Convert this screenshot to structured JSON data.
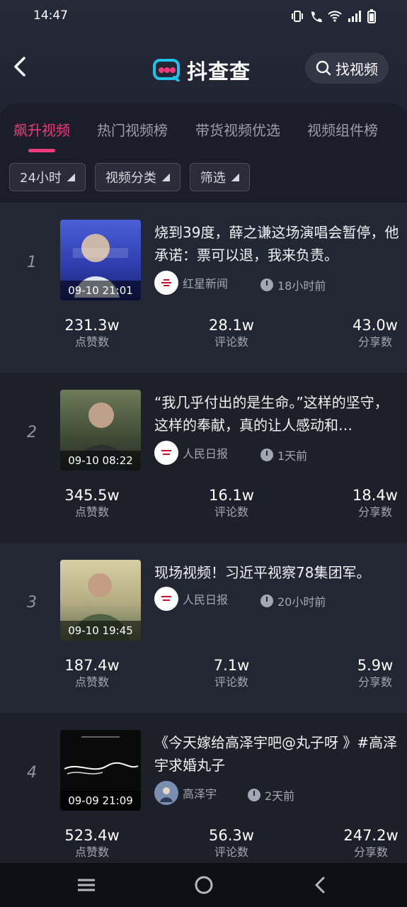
{
  "status": {
    "time": "14:47"
  },
  "header": {
    "logo_text": "抖查查",
    "find_label": "找视频"
  },
  "tabs": [
    {
      "label": "飙升视频"
    },
    {
      "label": "热门视频榜"
    },
    {
      "label": "带货视频优选"
    },
    {
      "label": "视频组件榜"
    }
  ],
  "filters": [
    {
      "label": "24小时"
    },
    {
      "label": "视频分类"
    },
    {
      "label": "筛选"
    }
  ],
  "items": [
    {
      "rank": "1",
      "date": "09-10 21:01",
      "title": "烧到39度，薛之谦这场演唱会暂停，他承诺：票可以退，我来负责。",
      "source": "红星新闻",
      "ago": "18小时前",
      "stats": [
        {
          "value": "231.3w",
          "label": "点赞数"
        },
        {
          "value": "28.1w",
          "label": "评论数"
        },
        {
          "value": "43.0w",
          "label": "分享数"
        }
      ]
    },
    {
      "rank": "2",
      "date": "09-10 08:22",
      "title": "“我几乎付出的是生命。”这样的坚守，这样的奉献，真的让人感动和…",
      "source": "人民日报",
      "ago": "1天前",
      "stats": [
        {
          "value": "345.5w",
          "label": "点赞数"
        },
        {
          "value": "16.1w",
          "label": "评论数"
        },
        {
          "value": "18.4w",
          "label": "分享数"
        }
      ]
    },
    {
      "rank": "3",
      "date": "09-10 19:45",
      "title": "现场视频！习近平视察78集团军。",
      "source": "人民日报",
      "ago": "20小时前",
      "stats": [
        {
          "value": "187.4w",
          "label": "点赞数"
        },
        {
          "value": "7.1w",
          "label": "评论数"
        },
        {
          "value": "5.9w",
          "label": "分享数"
        }
      ]
    },
    {
      "rank": "4",
      "date": "09-09 21:09",
      "title": "《今天嫁给高泽宇吧@丸子呀 》#高泽宇求婚丸子",
      "source": "高泽宇",
      "ago": "2天前",
      "stats": [
        {
          "value": "523.4w",
          "label": "点赞数"
        },
        {
          "value": "56.3w",
          "label": "评论数"
        },
        {
          "value": "247.2w",
          "label": "分享数"
        }
      ]
    }
  ],
  "colors": {
    "accent": "#ef3b7b",
    "background": "#171a23"
  }
}
